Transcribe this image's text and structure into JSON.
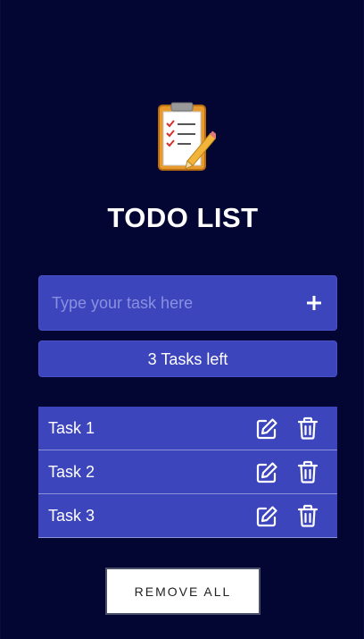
{
  "header": {
    "logo_icon": "clipboard-checklist-icon",
    "title": "TODO LIST"
  },
  "input": {
    "placeholder": "Type your task here",
    "value": "",
    "add_icon": "plus-icon"
  },
  "counter": {
    "text": "3 Tasks left"
  },
  "tasks": [
    {
      "label": "Task 1",
      "edit_icon": "edit-icon",
      "delete_icon": "trash-icon"
    },
    {
      "label": "Task 2",
      "edit_icon": "edit-icon",
      "delete_icon": "trash-icon"
    },
    {
      "label": "Task 3",
      "edit_icon": "edit-icon",
      "delete_icon": "trash-icon"
    }
  ],
  "footer": {
    "remove_all_label": "REMOVE ALL"
  },
  "colors": {
    "background": "#030533",
    "accent": "#3d45bc",
    "text": "#ffffff"
  }
}
